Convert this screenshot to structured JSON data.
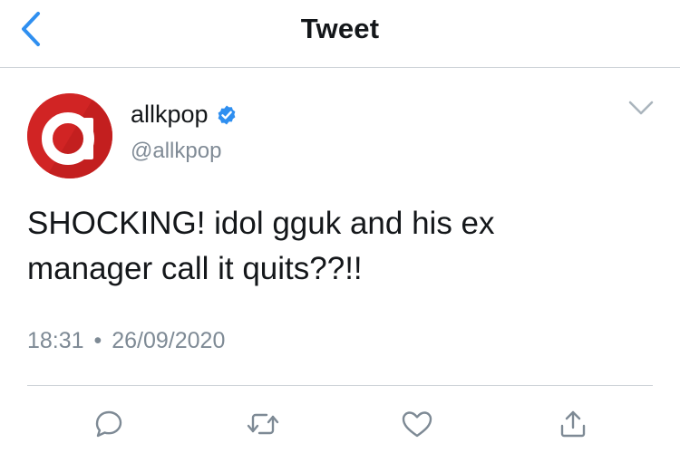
{
  "header": {
    "title": "Tweet",
    "back_icon": "chevron-left-icon",
    "accent_color": "#2f8ff0"
  },
  "tweet": {
    "author": {
      "name": "allkpop",
      "handle": "@allkpop",
      "verified": true,
      "avatar_color": "#d12424",
      "avatar_letter": "a"
    },
    "text_line1": "SHOCKING! idol gguk and his ex",
    "text_line2": "manager call it quits??!!",
    "time": "18:31",
    "separator": "•",
    "date": "26/09/2020"
  },
  "actions": [
    {
      "icon": "reply-icon"
    },
    {
      "icon": "retweet-icon"
    },
    {
      "icon": "like-icon"
    },
    {
      "icon": "share-icon"
    }
  ],
  "colors": {
    "text_primary": "#14171a",
    "text_secondary": "#7e8a95",
    "divider": "#cfd4d9",
    "icon_gray": "#7e8a95"
  }
}
